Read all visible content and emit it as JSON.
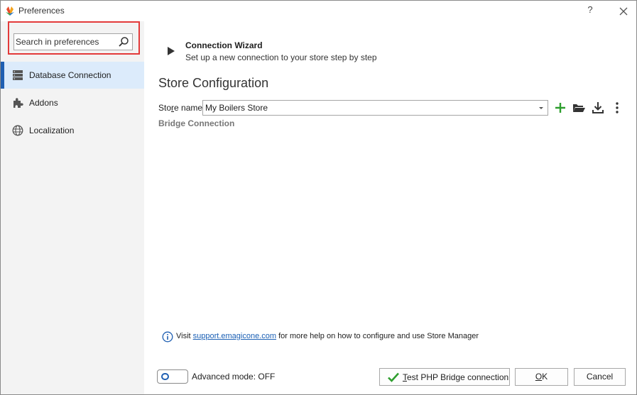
{
  "window": {
    "title": "Preferences",
    "help_label": "?"
  },
  "sidebar": {
    "search": {
      "placeholder": "Search in preferences",
      "value": ""
    },
    "items": [
      {
        "label": "Database Connection",
        "icon": "database-icon",
        "active": true
      },
      {
        "label": "Addons",
        "icon": "puzzle-icon",
        "active": false
      },
      {
        "label": "Localization",
        "icon": "globe-icon",
        "active": false
      }
    ]
  },
  "wizard": {
    "title": "Connection Wizard",
    "description": "Set up a new connection to your store step by step"
  },
  "store_config": {
    "title": "Store Configuration",
    "store_name_label_pre": "Sto",
    "store_name_label_u": "r",
    "store_name_label_post": "e name",
    "store_name_value": "My Boilers Store",
    "bridge_label": "Bridge Connection"
  },
  "info": {
    "prefix": "Visit ",
    "link": "support.emagicone.com",
    "suffix": " for more help on how to configure and use Store Manager"
  },
  "footer": {
    "advanced_mode_label": "Advanced mode: OFF",
    "test_button_u": "T",
    "test_button_rest": "est PHP Bridge connection",
    "ok_u": "O",
    "ok_rest": "K",
    "cancel_label": "Cancel"
  },
  "colors": {
    "accent": "#1f5fb2",
    "highlight": "#e33a3a",
    "active_bg": "#dcebfb",
    "add_green": "#2e9e2e",
    "check_green": "#2e9e2e"
  }
}
